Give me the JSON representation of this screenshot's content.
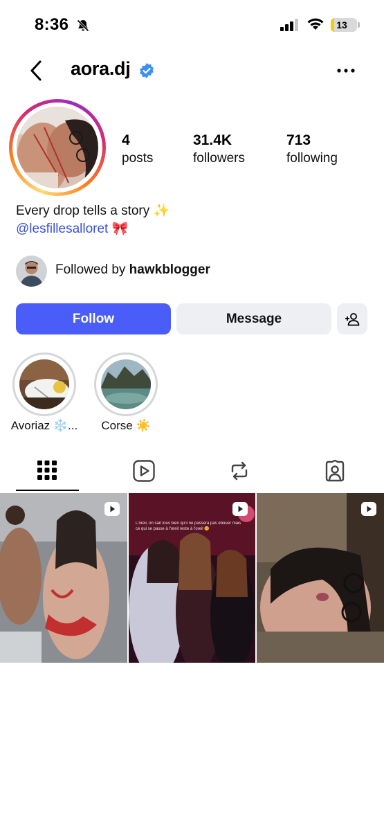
{
  "status_bar": {
    "time": "8:36",
    "battery_level": "13",
    "battery_fraction": 0.13,
    "battery_color": "#f5cc00"
  },
  "header": {
    "username": "aora.dj",
    "verified": true,
    "back_icon": "chevron-left-icon",
    "more_icon": "more-horizontal-icon"
  },
  "profile": {
    "stats": [
      {
        "value": "4",
        "label": "posts"
      },
      {
        "value": "31.4K",
        "label": "followers"
      },
      {
        "value": "713",
        "label": "following"
      }
    ],
    "bio": "Every drop tells a story ✨",
    "bio_link": "@lesfillesalloret 🎀",
    "followed_by_prefix": "Followed by ",
    "followed_by_user": "hawkblogger"
  },
  "actions": {
    "follow_label": "Follow",
    "message_label": "Message",
    "add_user_icon": "add-person-icon",
    "follow_color": "#4a5df9"
  },
  "highlights": [
    {
      "label": "Avoriaz ❄️..."
    },
    {
      "label": "Corse ☀️"
    }
  ],
  "tabs": [
    {
      "name": "grid",
      "icon": "grid-icon",
      "active": true
    },
    {
      "name": "reels",
      "icon": "reels-icon",
      "active": false
    },
    {
      "name": "reposts",
      "icon": "repost-icon",
      "active": false
    },
    {
      "name": "tagged",
      "icon": "tagged-person-icon",
      "active": false
    }
  ],
  "posts": [
    {
      "type": "reel",
      "icon": "reel-play-icon"
    },
    {
      "type": "reel",
      "icon": "reel-play-icon",
      "caption": "L'oreil, on sait tous bien qu'il ne passera pas ébouer mais ce qui se passe à l'oreil reste à l'oreil 🤫"
    },
    {
      "type": "reel",
      "icon": "reel-play-icon"
    }
  ]
}
